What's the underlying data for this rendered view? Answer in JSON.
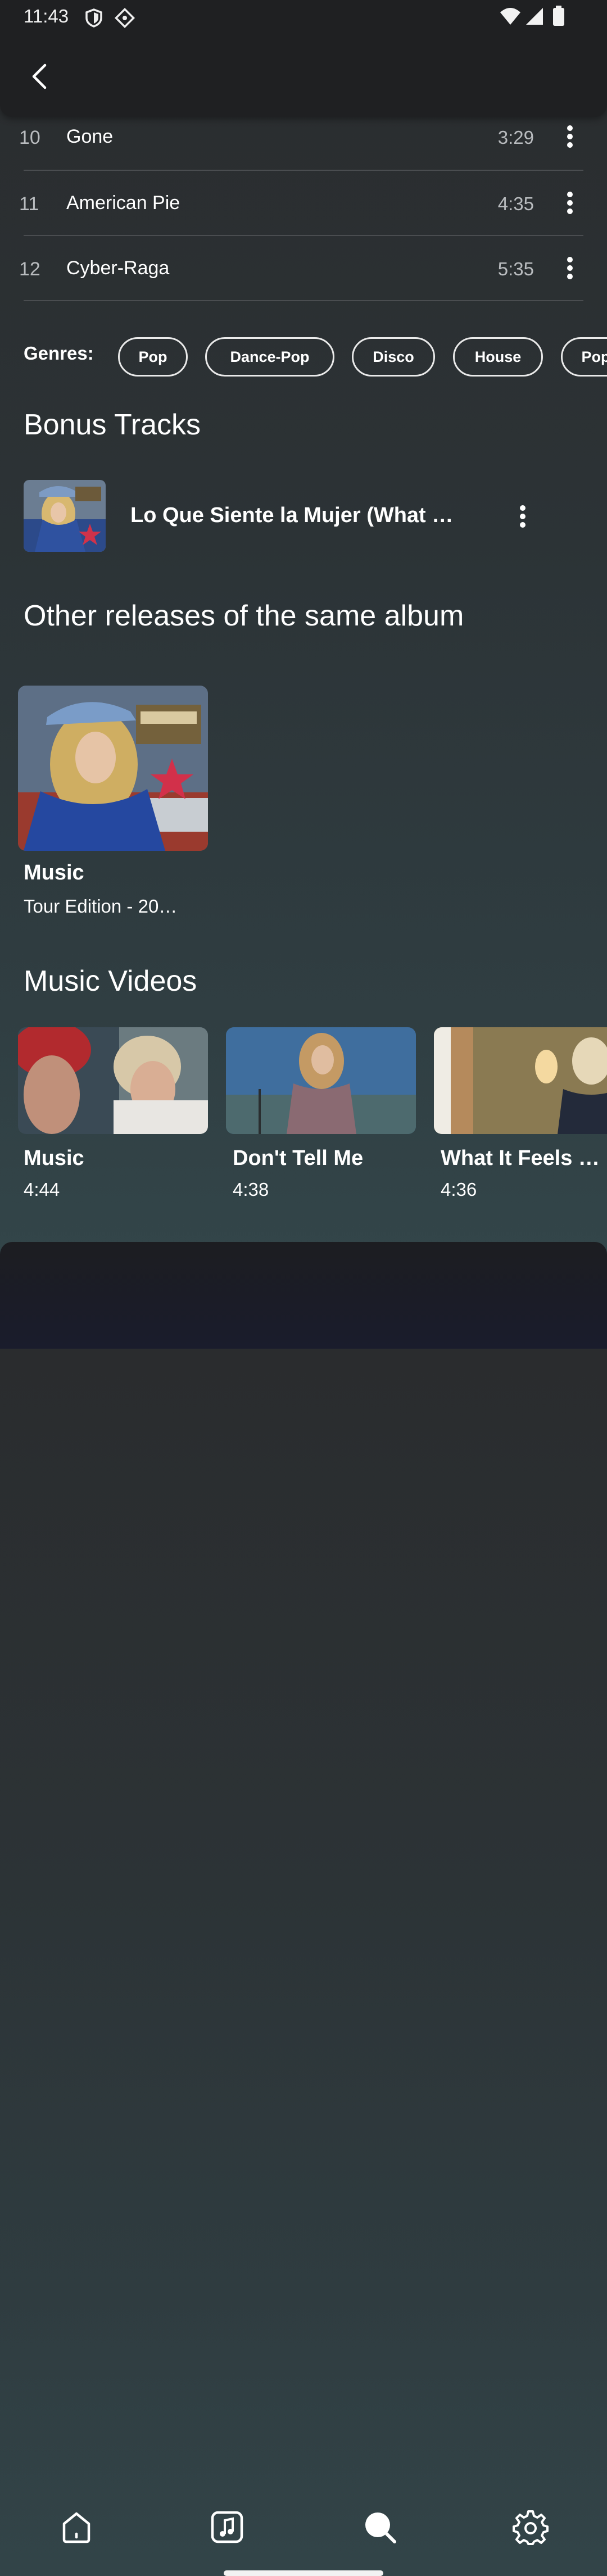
{
  "status_bar": {
    "time": "11:43"
  },
  "tracks": [
    {
      "number": "10",
      "title": "Gone",
      "duration": "3:29"
    },
    {
      "number": "11",
      "title": "American Pie",
      "duration": "4:35"
    },
    {
      "number": "12",
      "title": "Cyber-Raga",
      "duration": "5:35"
    }
  ],
  "genres": {
    "label": "Genres:",
    "items": [
      "Pop",
      "Dance-Pop",
      "Disco",
      "House",
      "Pop"
    ]
  },
  "bonus_tracks": {
    "title": "Bonus Tracks",
    "items": [
      {
        "title": "Lo Que Siente la Mujer (What …"
      }
    ]
  },
  "other_releases": {
    "title": "Other releases of the same album",
    "items": [
      {
        "title": "Music",
        "subtitle": "Tour Edition - 20…"
      }
    ]
  },
  "music_videos": {
    "title": "Music Videos",
    "items": [
      {
        "title": "Music",
        "duration": "4:44"
      },
      {
        "title": "Don't Tell Me",
        "duration": "4:38"
      },
      {
        "title": "What It Feels …",
        "duration": "4:36"
      }
    ]
  },
  "bottom_nav": {
    "items": [
      "home-icon",
      "library-icon",
      "search-icon",
      "settings-icon"
    ]
  }
}
